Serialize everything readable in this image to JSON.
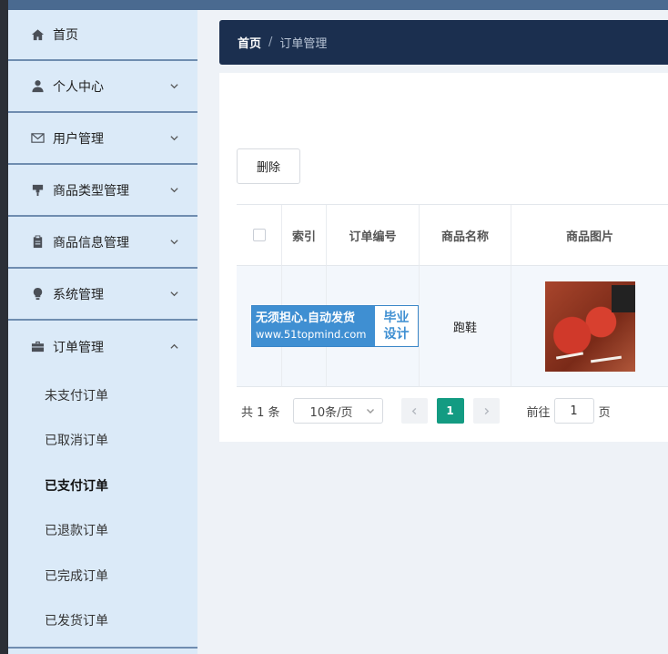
{
  "sidebar": {
    "items": [
      {
        "label": "首页",
        "icon": "home-icon"
      },
      {
        "label": "个人中心",
        "icon": "user-icon"
      },
      {
        "label": "用户管理",
        "icon": "mail-icon"
      },
      {
        "label": "商品类型管理",
        "icon": "stand-icon"
      },
      {
        "label": "商品信息管理",
        "icon": "clipboard-icon"
      },
      {
        "label": "系统管理",
        "icon": "bulb-icon"
      },
      {
        "label": "订单管理",
        "icon": "briefcase-icon"
      }
    ],
    "order_sub": [
      "未支付订单",
      "已取消订单",
      "已支付订单",
      "已退款订单",
      "已完成订单",
      "已发货订单"
    ]
  },
  "breadcrumb": {
    "home": "首页",
    "separator": "/",
    "current": "订单管理"
  },
  "toolbar": {
    "delete_label": "删除"
  },
  "table": {
    "columns": [
      "索引",
      "订单编号",
      "商品名称",
      "商品图片"
    ],
    "rows": [
      {
        "goods_name": "跑鞋",
        "image_desc": "shoe-image"
      }
    ]
  },
  "watermark": {
    "slogan": "无须担心.自动发货",
    "url": "www.51topmind.com",
    "tag_line1": "毕业",
    "tag_line2": "设计"
  },
  "pagination": {
    "total": "共 1 条",
    "page_size": "10条/页",
    "current_page": "1",
    "goto_prefix": "前往",
    "goto_value": "1",
    "goto_suffix": "页"
  },
  "colors": {
    "accent": "#139b82",
    "header": "#1b2f4f",
    "sidebar": "#dbeaf8"
  }
}
